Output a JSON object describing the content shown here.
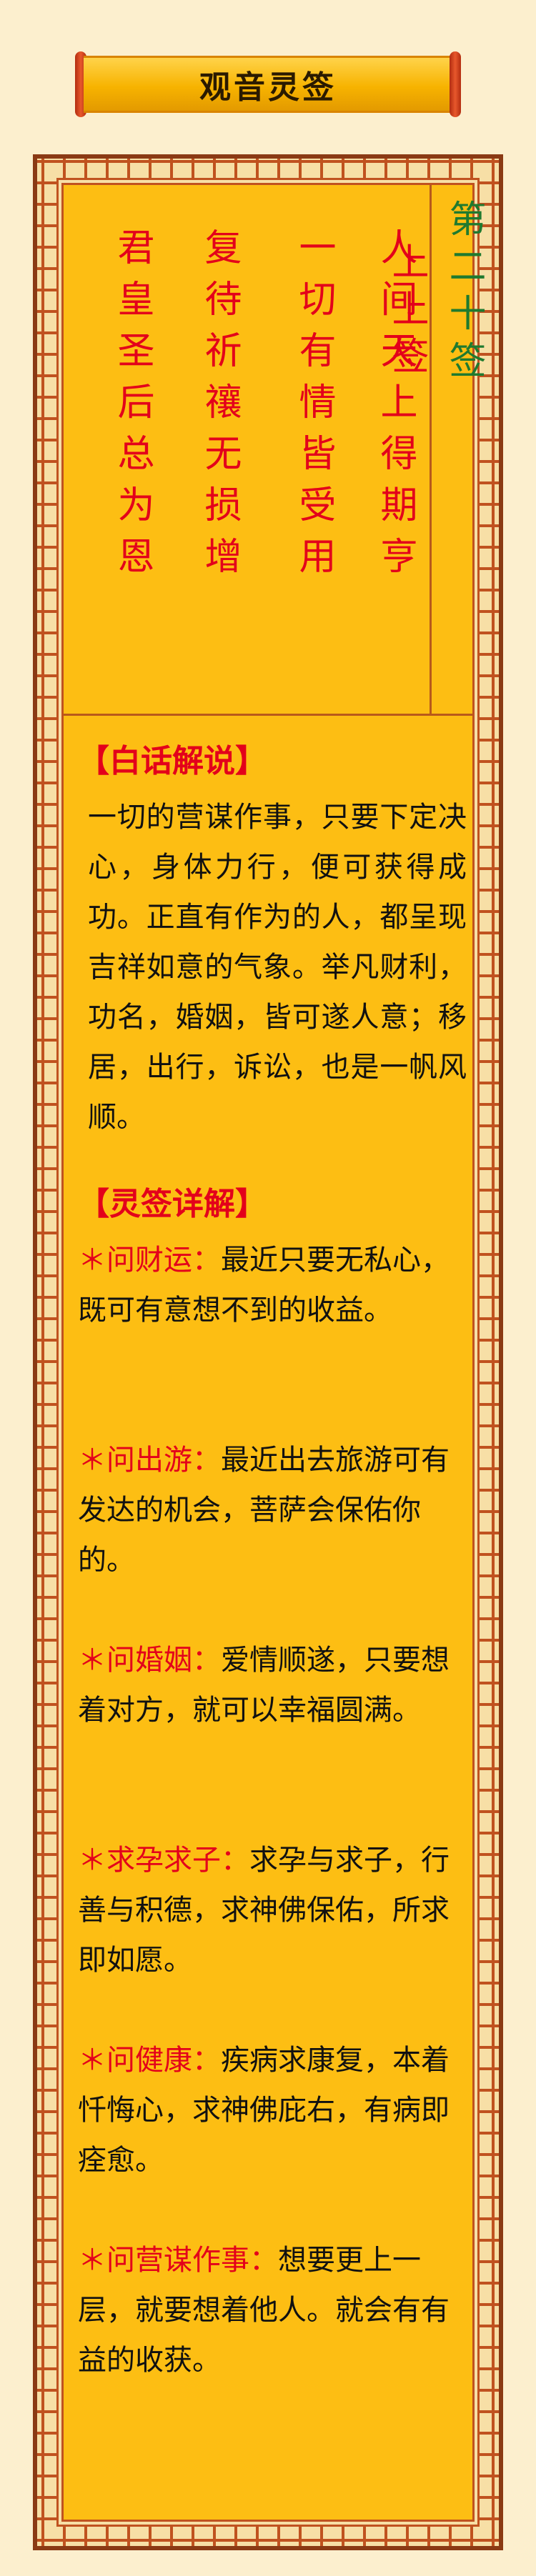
{
  "banner": {
    "title": "观音灵签"
  },
  "poem": {
    "columns": [
      "人间天上得期亨",
      "一切有情皆受用",
      "复待祈禳无损增",
      "君皇圣后总为恩"
    ]
  },
  "sign": {
    "number": "第二十签",
    "grade": "上上签"
  },
  "vernacular": {
    "heading": "【白话解说】",
    "text": "一切的营谋作事，只要下定决心，身体力行，便可获得成功。正直有作为的人，都呈现吉祥如意的气象。举凡财利，功名，婚姻，皆可遂人意；移居，出行，诉讼，也是一帆风顺。"
  },
  "detail": {
    "heading": "【灵签详解】",
    "star": "＊",
    "items": [
      {
        "label": "问财运：",
        "text": "最近只要无私心，既可有意想不到的收益。"
      },
      {
        "label": "问出游：",
        "text": "最近出去旅游可有发达的机会，菩萨会保佑你的。"
      },
      {
        "label": "问婚姻：",
        "text": "爱情顺遂，只要想着对方，就可以幸福圆满。"
      },
      {
        "label": "求孕求子：",
        "text": "求孕与求子，行善与积德，求神佛保佑，所求即如愿。"
      },
      {
        "label": "问健康：",
        "text": "疾病求康复，本着忏悔心，求神佛庇右，有病即痊愈。"
      },
      {
        "label": "问营谋作事：",
        "text": "想要更上一层，就要想着他人。就会有有益的收获。"
      }
    ]
  }
}
